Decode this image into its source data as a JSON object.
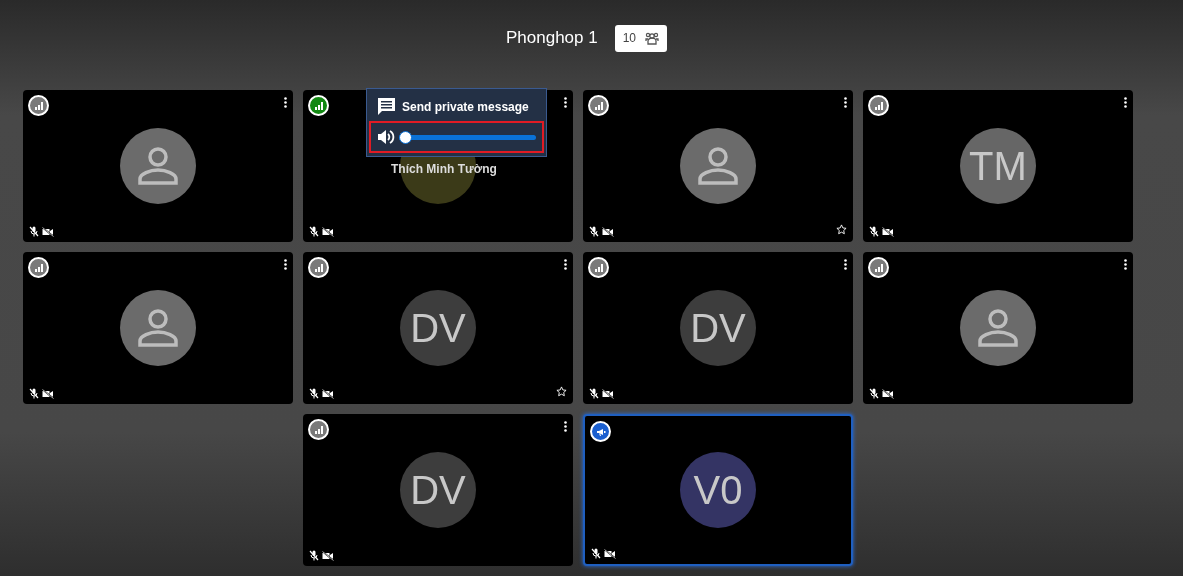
{
  "header": {
    "title": "Phonghop 1",
    "participant_count": "10"
  },
  "tiles": [
    {
      "avatar": {
        "kind": "person",
        "color": "#6b6b6b"
      },
      "status": {
        "kind": "signal",
        "color": "#7a7a7a"
      },
      "menu": true,
      "pinned": false,
      "speaking": false
    },
    {
      "avatar": {
        "kind": "blank",
        "color": "#3b3a18"
      },
      "status": {
        "kind": "signal",
        "color": "#128812"
      },
      "menu": true,
      "pinned": false,
      "speaking": false,
      "name": "Thích Minh Tường",
      "popup": {
        "action": "Send private message",
        "volume": {
          "level": 0
        }
      }
    },
    {
      "avatar": {
        "kind": "person",
        "color": "#6b6b6b"
      },
      "status": {
        "kind": "signal",
        "color": "#7a7a7a"
      },
      "menu": true,
      "pinned": true,
      "speaking": false
    },
    {
      "avatar": {
        "kind": "initials",
        "initials": "TM",
        "color": "#666666"
      },
      "status": {
        "kind": "signal",
        "color": "#7a7a7a"
      },
      "menu": true,
      "pinned": false,
      "speaking": false
    },
    {
      "avatar": {
        "kind": "person",
        "color": "#6b6b6b"
      },
      "status": {
        "kind": "signal",
        "color": "#7a7a7a"
      },
      "menu": true,
      "pinned": false,
      "speaking": false
    },
    {
      "avatar": {
        "kind": "initials",
        "initials": "DV",
        "color": "#3d3d3d"
      },
      "status": {
        "kind": "signal",
        "color": "#7a7a7a"
      },
      "menu": true,
      "pinned": true,
      "speaking": false
    },
    {
      "avatar": {
        "kind": "initials",
        "initials": "DV",
        "color": "#3d3d3d"
      },
      "status": {
        "kind": "signal",
        "color": "#7a7a7a"
      },
      "menu": true,
      "pinned": false,
      "speaking": false
    },
    {
      "avatar": {
        "kind": "person",
        "color": "#6b6b6b"
      },
      "status": {
        "kind": "signal",
        "color": "#7a7a7a"
      },
      "menu": true,
      "pinned": false,
      "speaking": false
    },
    {
      "avatar": {
        "kind": "initials",
        "initials": "DV",
        "color": "#3d3d3d"
      },
      "status": {
        "kind": "signal",
        "color": "#7a7a7a"
      },
      "menu": true,
      "pinned": false,
      "speaking": false
    },
    {
      "avatar": {
        "kind": "initials",
        "initials": "V0",
        "color": "#343464"
      },
      "status": {
        "kind": "speaker",
        "color": "#1b5fcf"
      },
      "menu": false,
      "pinned": false,
      "speaking": true
    }
  ]
}
